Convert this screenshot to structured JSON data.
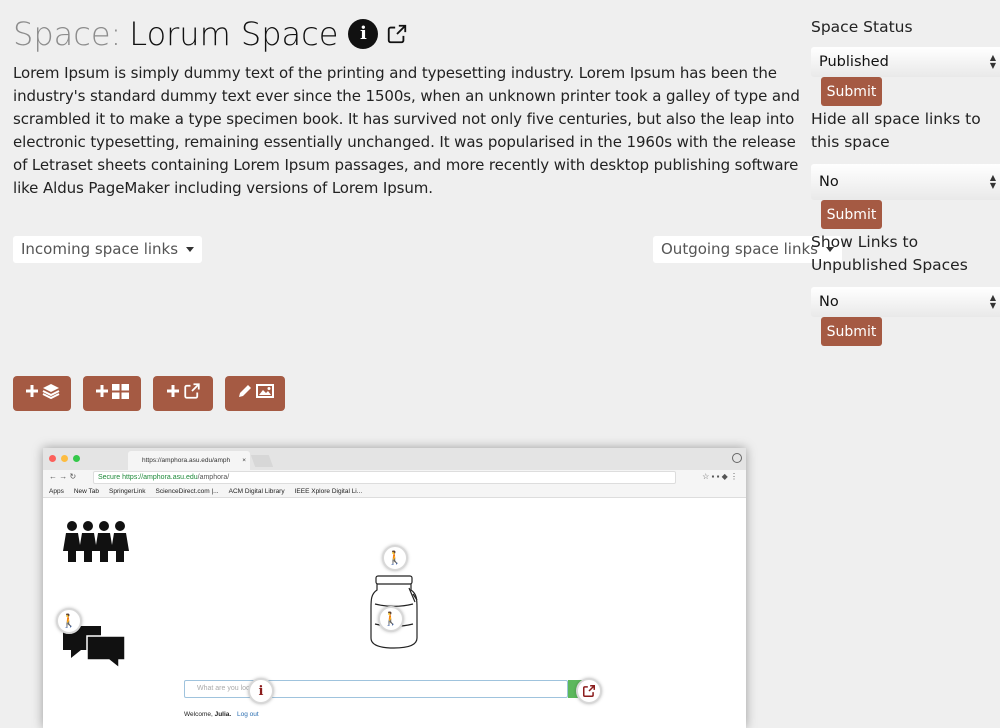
{
  "header": {
    "prefix": "Space:",
    "title": "Lorum Space",
    "description": "Lorem Ipsum is simply dummy text of the printing and typesetting industry. Lorem Ipsum has been the industry's standard dummy text ever since the 1500s, when an unknown printer took a galley of type and scrambled it to make a type specimen book. It has survived not only five centuries, but also the leap into electronic typesetting, remaining essentially unchanged. It was popularised in the 1960s with the release of Letraset sheets containing Lorem Ipsum passages, and more recently with desktop publishing software like Aldus PageMaker including versions of Lorem Ipsum."
  },
  "links": {
    "incoming": "Incoming space links",
    "outgoing": "Outgoing space links"
  },
  "sidebar": {
    "status_label": "Space Status",
    "status_value": "Published",
    "hide_label": "Hide all space links to this space",
    "hide_value": "No",
    "unpub_label": "Show Links to Unpublished Spaces",
    "unpub_value": "No",
    "submit_label": "Submit"
  },
  "toolbar": {
    "icons": [
      "add-layers-icon",
      "add-grid-icon",
      "add-external-link-icon",
      "edit-image-icon"
    ]
  },
  "screenshot": {
    "tab_title": "https://amphora.asu.edu/amph",
    "tab_close": "×",
    "url_secure": "Secure",
    "url_host": "https://amphora.asu.edu",
    "url_path": "/amphora/",
    "bookmarks": [
      "Apps",
      "New Tab",
      "SpringerLink",
      "ScienceDirect.com |...",
      "ACM Digital Library",
      "IEEE Xplore Digital Li..."
    ],
    "search_placeholder": "What are you looking",
    "welcome": "Welcome,",
    "user": "Julia.",
    "logout": "Log out"
  },
  "colors": {
    "accent": "#a55a43",
    "background": "#efefef"
  }
}
